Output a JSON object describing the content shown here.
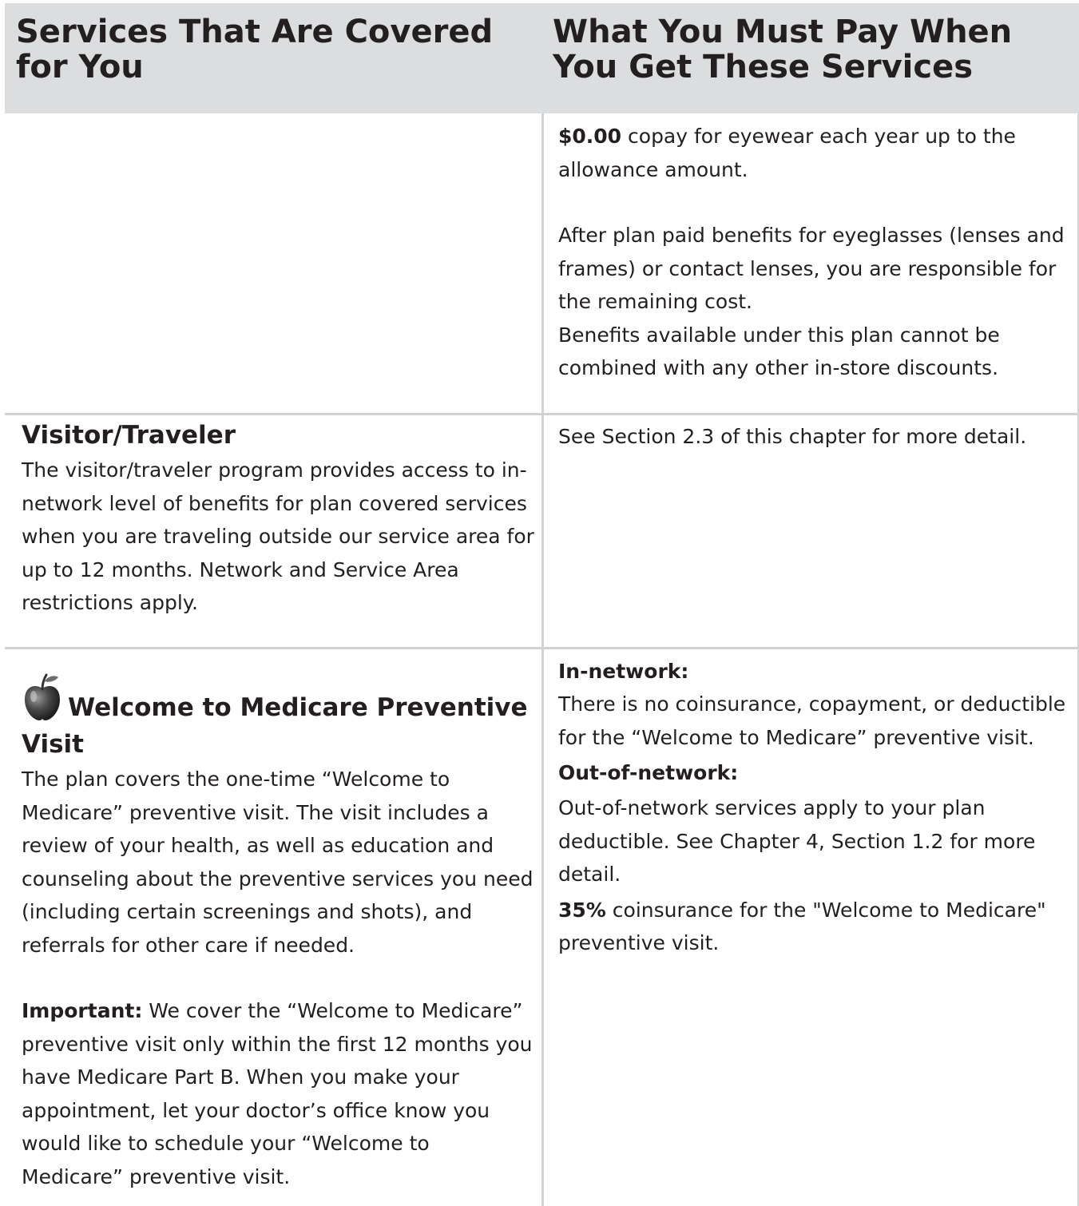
{
  "header": {
    "left": "Services That Are Covered for You",
    "right": "What You Must Pay When You Get These Services"
  },
  "rows": [
    {
      "right": {
        "line1_bold": "$0.00",
        "line1_rest": " copay for eyewear each year up to the allowance amount.",
        "para2": "After plan paid benefits for eyeglasses (lenses and frames) or contact lenses, you are responsible for the remaining cost.",
        "para3": "Benefits available under this plan cannot be combined with any other in-store discounts."
      }
    },
    {
      "left": {
        "title": "Visitor/Traveler",
        "body": "The visitor/traveler program provides access to in-network level of benefits for plan covered services when you are traveling outside our service area for up to 12 months. Network and Service Area restrictions apply."
      },
      "right": {
        "body": "See Section 2.3 of this chapter for more detail."
      }
    },
    {
      "left": {
        "icon": "apple-icon",
        "title": "Welcome to Medicare Preventive Visit",
        "body": "The plan covers the one-time “Welcome to Medicare” preventive visit. The visit includes a review of your health, as well as education and counseling about the preventive services you need (including certain screenings and shots), and referrals for other care if needed.",
        "important_label": "Important:",
        "important_body": " We cover the “Welcome to Medicare” preventive visit only within the first 12 months you have Medicare Part B. When you make your appointment, let your doctor’s office know you would like to schedule your “Welcome to Medicare” preventive visit."
      },
      "right": {
        "in_network_label": "In-network:",
        "in_network_body": "There is no coinsurance, copayment, or deductible for the “Welcome to Medicare” preventive visit.",
        "out_network_label": "Out-of-network:",
        "out_network_body": "Out-of-network services apply to your plan deductible. See Chapter 4, Section 1.2 for more detail.",
        "coins_bold": "35%",
        "coins_rest": " coinsurance for the \"Welcome to Medicare\" preventive visit."
      }
    }
  ]
}
